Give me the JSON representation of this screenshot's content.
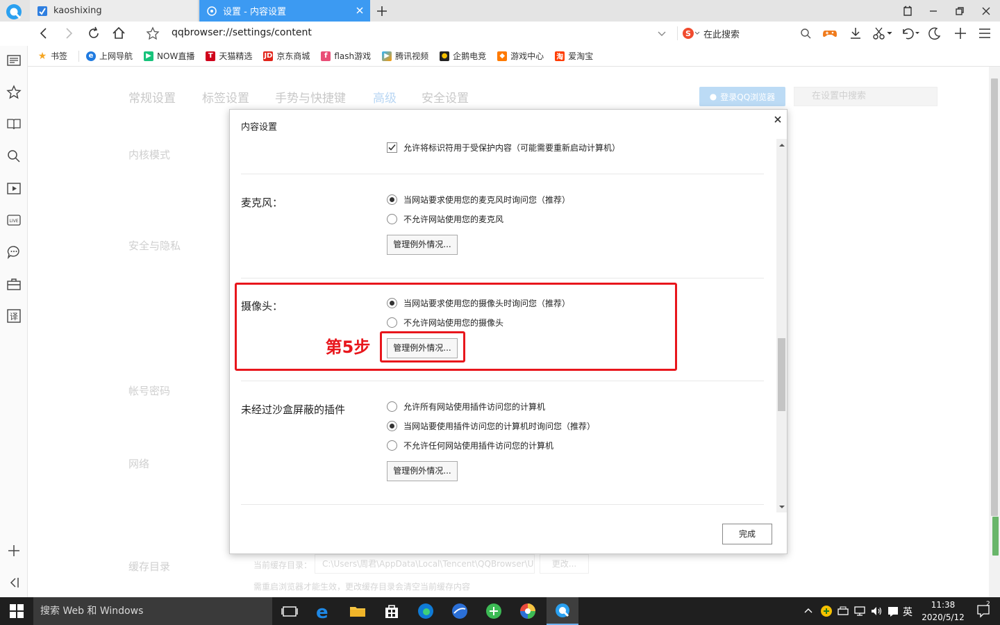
{
  "tabs": [
    {
      "label": "kaoshixing"
    },
    {
      "label": "设置 - 内容设置"
    }
  ],
  "address": {
    "url": "qqbrowser://settings/content",
    "search_placeholder": "在此搜索"
  },
  "bookmarks": [
    {
      "label": "书签",
      "icon": "star-icon",
      "color": "#f5a623"
    },
    {
      "label": "上网导航",
      "icon": "e-icon",
      "color": "#1f7ae0"
    },
    {
      "label": "NOW直播",
      "icon": "now-icon",
      "color": "#17c37b"
    },
    {
      "label": "天猫精选",
      "icon": "tmall-icon",
      "color": "#d0021b"
    },
    {
      "label": "京东商城",
      "icon": "jd-icon",
      "color": "#e1251b"
    },
    {
      "label": "flash游戏",
      "icon": "flash-icon",
      "color": "#e94e77"
    },
    {
      "label": "腾讯视频",
      "icon": "video-icon",
      "color": "#ff9a00"
    },
    {
      "label": "企鹅电竞",
      "icon": "penguin-icon",
      "color": "#222222"
    },
    {
      "label": "游戏中心",
      "icon": "game-icon",
      "color": "#ff7a00"
    },
    {
      "label": "爱淘宝",
      "icon": "taobao-icon",
      "color": "#ff3c00"
    }
  ],
  "settings_tabs": [
    "常规设置",
    "标签设置",
    "手势与快捷键",
    "高级",
    "安全设置"
  ],
  "login_label": "登录QQ浏览器",
  "settings_search_placeholder": "在设置中搜索",
  "sections": [
    "内核模式",
    "安全与隐私",
    "帐号密码",
    "网络",
    "缓存目录"
  ],
  "cache": {
    "label": "当前缓存目录：",
    "path": "C:\\Users\\周君\\AppData\\Local\\Tencent\\QQBrowser\\U",
    "change_button": "更改...",
    "note": "需重启浏览器才能生效，更改缓存目录会清空当前缓存内容"
  },
  "dialog": {
    "title": "内容设置",
    "protected_content_option": "允许将标识符用于受保护内容（可能需要重新启动计算机）",
    "microphone": {
      "label": "麦克风：",
      "options": [
        "当网站要求使用您的麦克风时询问您（推荐）",
        "不允许网站使用您的麦克风"
      ],
      "selected": 0,
      "button": "管理例外情况..."
    },
    "camera": {
      "label": "摄像头：",
      "options": [
        "当网站要求使用您的摄像头时询问您（推荐）",
        "不允许网站使用您的摄像头"
      ],
      "selected": 0,
      "button": "管理例外情况..."
    },
    "plugins": {
      "label": "未经过沙盒屏蔽的插件",
      "options": [
        "允许所有网站使用插件访问您的计算机",
        "当网站要使用插件访问您的计算机时询问您（推荐）",
        "不允许任何网站使用插件访问您的计算机"
      ],
      "selected": 1,
      "button": "管理例外情况..."
    },
    "done_button": "完成"
  },
  "annotation": {
    "step_label": "第5步",
    "color": "#e8161c"
  },
  "taskbar": {
    "search_placeholder": "搜索 Web 和 Windows",
    "time": "11:38",
    "date": "2020/5/12",
    "ime": "英",
    "notification_count": "2"
  },
  "colors": {
    "accent": "#3c9af2",
    "annotation": "#e8161c"
  }
}
